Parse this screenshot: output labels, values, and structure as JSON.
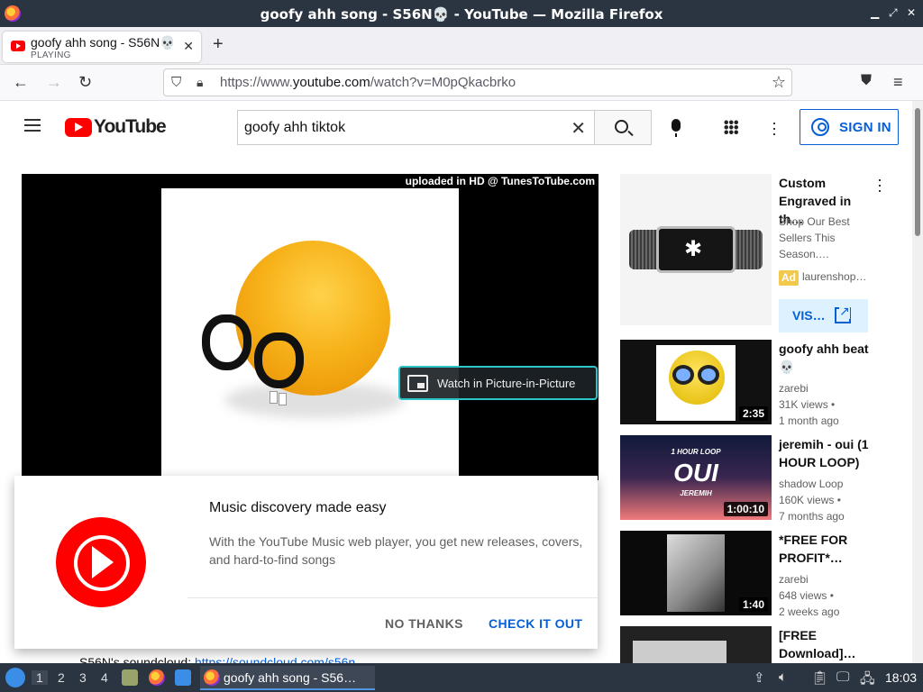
{
  "window": {
    "title": "goofy ahh song - S56N💀 - YouTube — Mozilla Firefox"
  },
  "tab": {
    "title": "goofy ahh song - S56N💀",
    "status": "PLAYING"
  },
  "nav": {
    "url_prefix": "https://www.",
    "url_domain": "youtube.com",
    "url_path": "/watch?v=M0pQkacbrko"
  },
  "youtube": {
    "wordmark": "YouTube",
    "search_query": "goofy ahh tiktok",
    "sign_in": "SIGN IN"
  },
  "player": {
    "watermark": "uploaded in HD @ TunesToTube.com",
    "pip_label": "Watch in Picture-in-Picture"
  },
  "promo": {
    "title": "Music discovery made easy",
    "body": "With the YouTube Music web player, you get new releases, covers, and hard-to-find songs",
    "no_thanks": "NO THANKS",
    "check_it_out": "CHECK IT OUT"
  },
  "description": {
    "prefix": "S56N's soundcloud: ",
    "link": "https://soundcloud.com/s56n"
  },
  "ad": {
    "title": "Custom Engraved in th…",
    "description": "Shop Our Best Sellers This Season.…",
    "badge": "Ad",
    "domain": "laurenshop…",
    "visit": "VIS…"
  },
  "videos": [
    {
      "title": "goofy ahh beat 💀",
      "channel": "zarebi",
      "views": "31K views •",
      "age": "1 month ago",
      "duration": "2:35"
    },
    {
      "title": "jeremih - oui (1 HOUR LOOP)",
      "channel": "shadow Loop",
      "views": "160K views •",
      "age": "7 months ago",
      "duration": "1:00:10",
      "thumb_text1": "1 HOUR LOOP",
      "thumb_text2": "OUI",
      "thumb_text3": "JEREMIH"
    },
    {
      "title": "*FREE FOR PROFIT*…",
      "channel": "zarebi",
      "views": "648 views •",
      "age": "2 weeks ago",
      "duration": "1:40"
    },
    {
      "title": "[FREE Download]…"
    }
  ],
  "taskbar": {
    "workspaces": [
      "1",
      "2",
      "3",
      "4"
    ],
    "task_label": "goofy ahh song - S56…",
    "clock": "18:03"
  },
  "colors": {
    "youtube_red": "#ff0000",
    "link_blue": "#065fd4",
    "panel_dark": "#2b3441"
  }
}
